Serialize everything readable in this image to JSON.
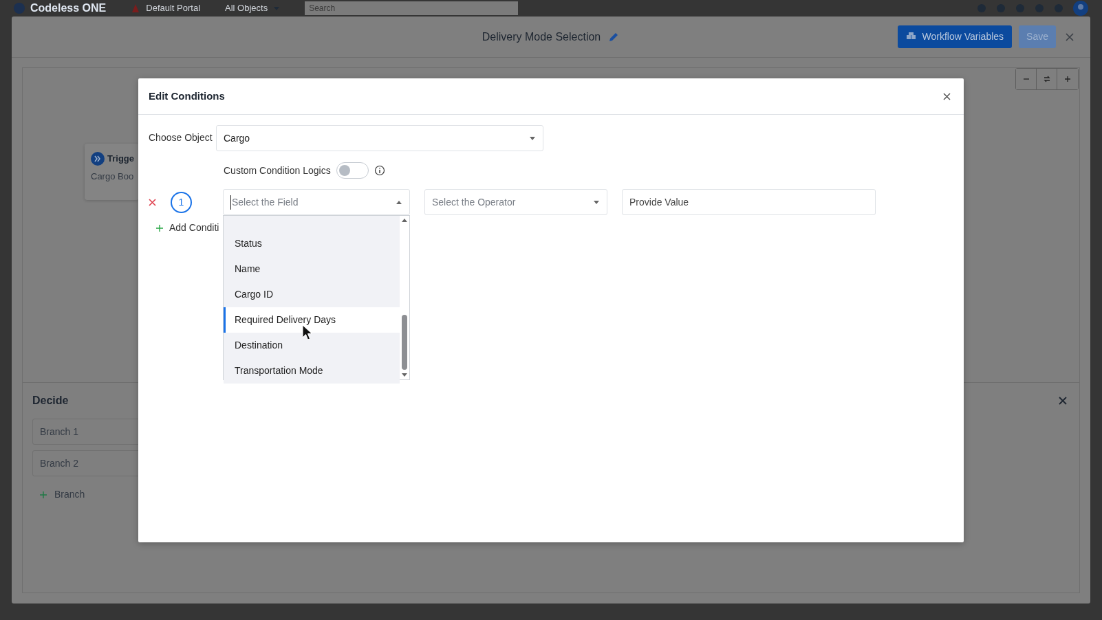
{
  "app_header": {
    "logo": "Codeless ONE",
    "portal": "Default Portal",
    "object_filter": "All Objects",
    "search": {
      "placeholder": "Search"
    }
  },
  "workflow": {
    "title": "Delivery Mode Selection",
    "buttons": [
      {
        "label": "Workflow Variables",
        "kind": "primary"
      },
      {
        "label": "Save",
        "kind": "save"
      }
    ]
  },
  "canvas": {
    "trigger": {
      "title": "Trigge",
      "subtitle": "Cargo Boo"
    }
  },
  "decide": {
    "title": "Decide",
    "branches": [
      "Branch 1",
      "Branch 2"
    ],
    "add_label": "Branch"
  },
  "modal": {
    "title": "Edit Conditions",
    "object_label": "Choose Object",
    "object_value": "Cargo",
    "custom_logic": {
      "label": "Custom Condition Logics",
      "on": false
    },
    "conditions": [
      {
        "number": "1",
        "field": {
          "placeholder": "Select the Field",
          "expanded": true,
          "options": [
            {
              "label": "Status",
              "selected": false
            },
            {
              "label": "Name",
              "selected": false
            },
            {
              "label": "Cargo ID",
              "selected": false
            },
            {
              "label": "Required Delivery Days",
              "selected": true
            },
            {
              "label": "Destination",
              "selected": false
            },
            {
              "label": "Transportation Mode",
              "selected": false
            }
          ]
        },
        "operator": {
          "placeholder": "Select the Operator"
        },
        "value": {
          "placeholder": "Provide Value"
        }
      }
    ],
    "add_condition": "Add Conditi"
  }
}
